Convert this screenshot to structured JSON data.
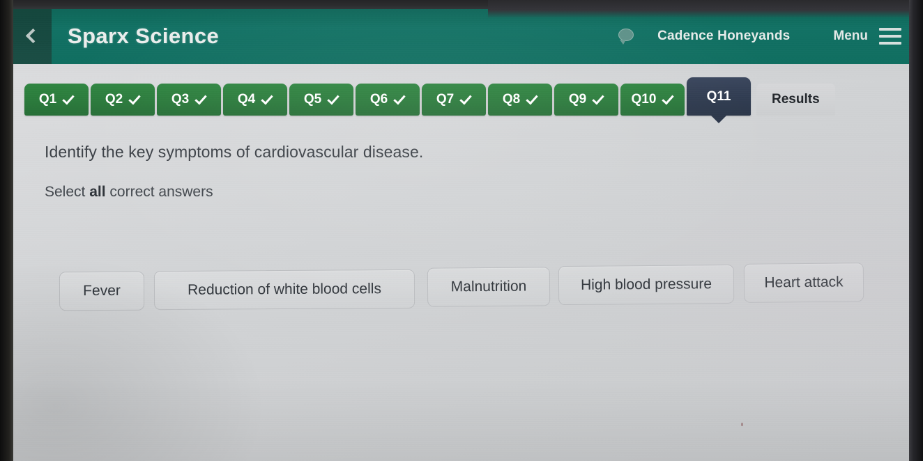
{
  "app": {
    "title": "Sparx Science",
    "back_icon": "chevron-left-icon"
  },
  "topbar": {
    "chat_icon": "speech-bubble-icon",
    "user_name": "Cadence Honeyands",
    "menu_label": "Menu",
    "menu_icon": "hamburger-icon",
    "background_color": "#127567",
    "back_zone_color": "#1a4e45"
  },
  "tabs": {
    "items": [
      {
        "label": "Q1",
        "state": "complete",
        "tick": "check-icon"
      },
      {
        "label": "Q2",
        "state": "complete",
        "tick": "check-icon"
      },
      {
        "label": "Q3",
        "state": "complete",
        "tick": "check-icon"
      },
      {
        "label": "Q4",
        "state": "complete",
        "tick": "check-icon"
      },
      {
        "label": "Q5",
        "state": "complete",
        "tick": "check-icon"
      },
      {
        "label": "Q6",
        "state": "complete",
        "tick": "check-icon"
      },
      {
        "label": "Q7",
        "state": "complete",
        "tick": "check-icon"
      },
      {
        "label": "Q8",
        "state": "complete",
        "tick": "check-icon"
      },
      {
        "label": "Q9",
        "state": "complete",
        "tick": "check-icon"
      },
      {
        "label": "Q10",
        "state": "complete",
        "tick": "check-icon"
      },
      {
        "label": "Q11",
        "state": "active",
        "tick": ""
      }
    ],
    "results_label": "Results",
    "complete_color": "#2a7a3b",
    "active_color": "#2e3a4f"
  },
  "question": {
    "prompt": "Identify the key symptoms of cardiovascular disease.",
    "instruction_prefix": "Select ",
    "instruction_emphasis": "all",
    "instruction_suffix": " correct answers",
    "options": [
      {
        "label": "Fever",
        "selected": false
      },
      {
        "label": "Reduction of white blood cells",
        "selected": false
      },
      {
        "label": "Malnutrition",
        "selected": false
      },
      {
        "label": "High blood pressure",
        "selected": false
      },
      {
        "label": "Heart attack",
        "selected": false
      }
    ]
  }
}
